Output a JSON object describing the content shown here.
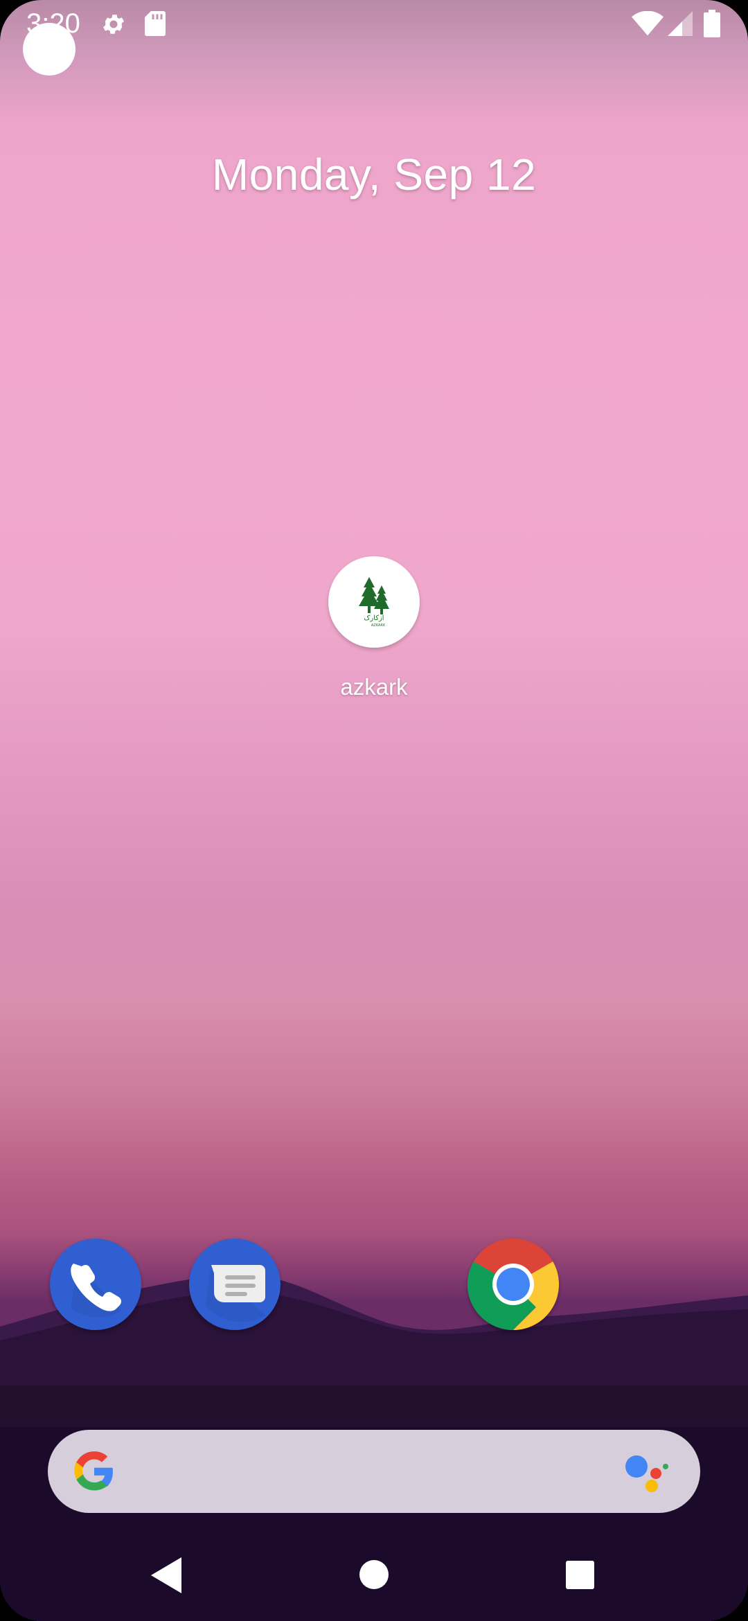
{
  "status_bar": {
    "time": "3:20",
    "icons": [
      "settings-icon",
      "sd-card-icon",
      "wifi-icon",
      "cell-signal-icon",
      "battery-icon"
    ]
  },
  "home": {
    "date": "Monday, Sep 12",
    "apps": [
      {
        "label": "azkark",
        "icon": "azkark-app-icon"
      }
    ]
  },
  "dock": {
    "apps": [
      "phone-icon",
      "messages-icon",
      "chrome-icon"
    ]
  },
  "search_bar": {
    "icons": [
      "google-g-icon",
      "google-assistant-icon"
    ]
  },
  "nav_bar": {
    "buttons": [
      "back-icon",
      "home-icon",
      "recents-icon"
    ]
  },
  "colors": {
    "search_bar": "#d6cfdb",
    "phone_blue": "#2f5fd0",
    "azkark_green": "#1f6b2a"
  }
}
